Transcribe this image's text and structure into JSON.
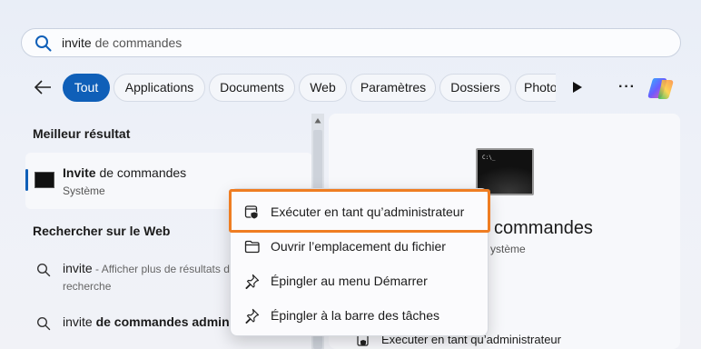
{
  "search": {
    "typed": "invite",
    "rest": " de commandes"
  },
  "filters": {
    "chips": [
      "Tout",
      "Applications",
      "Documents",
      "Web",
      "Paramètres",
      "Dossiers",
      "Photo"
    ],
    "active": "Tout"
  },
  "best_match": {
    "section_title": "Meilleur résultat",
    "title_bold": "Invite",
    "title_rest": " de commandes",
    "subtitle": "Système"
  },
  "web_search": {
    "section_title": "Rechercher sur le Web",
    "items": [
      {
        "bold": "invite",
        "rest": " - Afficher plus de résultats de",
        "line2": "recherche"
      },
      {
        "plain": "invite ",
        "bold": "de commandes admin"
      }
    ]
  },
  "detail_panel": {
    "title": "commandes",
    "subtitle": "ystème",
    "action_label": "Exécuter en tant qu’administrateur",
    "icon_prompt": "C:\\_"
  },
  "context_menu": {
    "items": [
      {
        "label": "Exécuter en tant qu’administrateur",
        "icon": "run-as-admin-icon"
      },
      {
        "label": "Ouvrir l’emplacement du fichier",
        "icon": "folder-icon"
      },
      {
        "label": "Épingler au menu Démarrer",
        "icon": "pin-icon"
      },
      {
        "label": "Épingler à la barre des tâches",
        "icon": "pin-icon"
      }
    ]
  },
  "colors": {
    "accent": "#0f5fb8",
    "highlight": "#ef7d22"
  }
}
